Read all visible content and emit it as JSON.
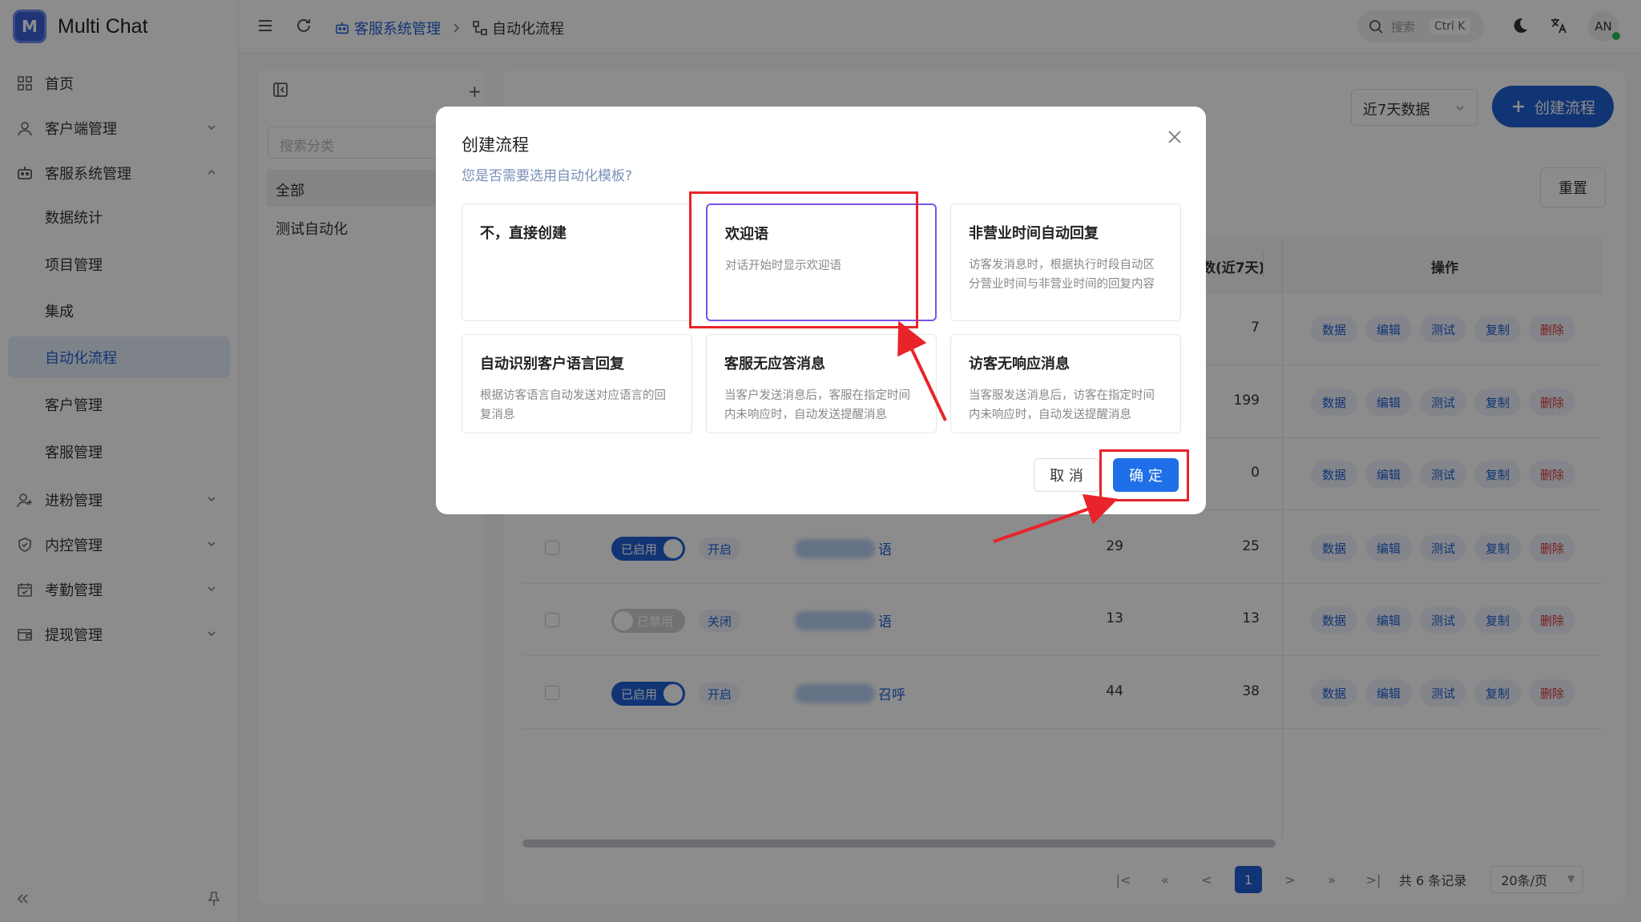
{
  "app": {
    "title": "Multi Chat",
    "logo_letter": "M"
  },
  "sidebar": {
    "items": [
      {
        "label": "首页",
        "icon": "grid-icon"
      },
      {
        "label": "客户端管理",
        "icon": "user-icon",
        "chevron": "down"
      },
      {
        "label": "客服系统管理",
        "icon": "robot-icon",
        "chevron": "up"
      },
      {
        "label": "进粉管理",
        "icon": "user-plus-icon",
        "chevron": "down"
      },
      {
        "label": "内控管理",
        "icon": "shield-icon",
        "chevron": "down"
      },
      {
        "label": "考勤管理",
        "icon": "calendar-icon",
        "chevron": "down"
      },
      {
        "label": "提现管理",
        "icon": "wallet-icon",
        "chevron": "down"
      }
    ],
    "sub_items": [
      "数据统计",
      "项目管理",
      "集成",
      "自动化流程",
      "客户管理",
      "客服管理"
    ],
    "active_sub": "自动化流程"
  },
  "header": {
    "breadcrumb": [
      "客服系统管理",
      "自动化流程"
    ],
    "search_placeholder": "搜索",
    "search_shortcut": "Ctrl K",
    "avatar": "AN"
  },
  "categories": {
    "search_placeholder": "搜索分类",
    "items": [
      "全部",
      "测试自动化"
    ]
  },
  "main": {
    "range_select": "近7天数据",
    "create_button": "创建流程",
    "reset_button": "重置",
    "columns": [
      "数(近7天)",
      "操作"
    ],
    "ops": [
      "数据",
      "编辑",
      "测试",
      "复制",
      "删除"
    ],
    "rows": [
      {
        "status": "",
        "tag": "",
        "name_tail": "",
        "c1": "",
        "c2": "7"
      },
      {
        "status": "",
        "tag": "",
        "name_tail": "",
        "c1": "",
        "c2": "199"
      },
      {
        "status": "",
        "tag": "",
        "name_tail": "",
        "c1": "",
        "c2": "0"
      },
      {
        "status": "已启用",
        "enabled": true,
        "tag": "开启",
        "name_tail": "语",
        "c1": "29",
        "c2": "25"
      },
      {
        "status": "已禁用",
        "enabled": false,
        "tag": "关闭",
        "name_tail": "语",
        "c1": "13",
        "c2": "13"
      },
      {
        "status": "已启用",
        "enabled": true,
        "tag": "开启",
        "name_tail": "召呼",
        "c1": "44",
        "c2": "38"
      }
    ],
    "pagination": {
      "current": "1",
      "total": "共 6 条记录",
      "page_size": "20条/页"
    }
  },
  "modal": {
    "title": "创建流程",
    "subtitle": "您是否需要选用自动化模板?",
    "cards": [
      {
        "title": "不，直接创建",
        "desc": ""
      },
      {
        "title": "欢迎语",
        "desc": "对话开始时显示欢迎语",
        "selected": true
      },
      {
        "title": "非营业时间自动回复",
        "desc": "访客发消息时，根据执行时段自动区分营业时间与非营业时间的回复内容"
      },
      {
        "title": "自动识别客户语言回复",
        "desc": "根据访客语言自动发送对应语言的回复消息"
      },
      {
        "title": "客服无应答消息",
        "desc": "当客户发送消息后，客服在指定时间内未响应时，自动发送提醒消息"
      },
      {
        "title": "访客无响应消息",
        "desc": "当客服发送消息后，访客在指定时间内未响应时，自动发送提醒消息"
      }
    ],
    "cancel": "取 消",
    "confirm": "确 定"
  },
  "colors": {
    "primary": "#1f5fd6",
    "highlight": "#e8242a",
    "selected_border": "#7a52e8",
    "danger": "#e03434"
  }
}
